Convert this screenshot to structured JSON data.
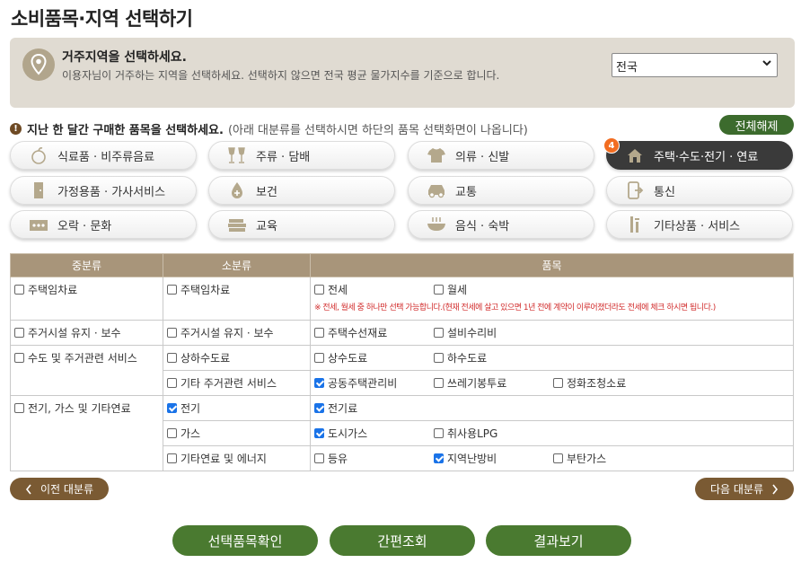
{
  "title": "소비품목·지역 선택하기",
  "region": {
    "heading": "거주지역을 선택하세요.",
    "desc": "이용자님이 거주하는 지역을 선택하세요. 선택하지 않으면 전국 평균 물가지수를 기준으로 합니다.",
    "selected": "전국"
  },
  "instruction": {
    "main": "지난 한 달간 구매한 품목을 선택하세요.",
    "sub": "(아래 대분류를 선택하시면 하단의 품목 선택화면이 나옵니다)"
  },
  "clear_all": "전체해제",
  "categories": [
    {
      "label": "식료품 · 비주류음료",
      "icon": "apple-icon"
    },
    {
      "label": "주류 · 담배",
      "icon": "wine-glasses-icon"
    },
    {
      "label": "의류 · 신발",
      "icon": "shirt-icon"
    },
    {
      "label": "주택·수도·전기 · 연료",
      "icon": "house-icon",
      "active": true,
      "badge": "4"
    },
    {
      "label": "가정용품 · 가사서비스",
      "icon": "door-icon"
    },
    {
      "label": "보건",
      "icon": "drop-icon"
    },
    {
      "label": "교통",
      "icon": "car-icon"
    },
    {
      "label": "통신",
      "icon": "phone-icon"
    },
    {
      "label": "오락 · 문화",
      "icon": "theater-icon"
    },
    {
      "label": "교육",
      "icon": "books-icon"
    },
    {
      "label": "음식 · 숙박",
      "icon": "bowl-icon"
    },
    {
      "label": "기타상품 · 서비스",
      "icon": "tools-icon"
    }
  ],
  "table": {
    "headers": [
      "중분류",
      "소분류",
      "품목"
    ],
    "mid": [
      "주택임차료",
      "주거시설 유지 · 보수",
      "수도 및 주거관련 서비스",
      "전기, 가스 및 기타연료"
    ],
    "sub": [
      "주택임차료",
      "주거시설 유지 · 보수",
      "상하수도료",
      "기타 주거관련 서비스",
      "전기",
      "가스",
      "기타연료 및 에너지"
    ],
    "items": {
      "jeonse": "전세",
      "wolse": "월세",
      "note": "※ 전세, 월세 중 하나만 선택 가능합니다.(현재 전세에 살고 있으면 1년 전에 계약이 이루어졌더라도 전세에 체크 하시면 됩니다.)",
      "repair_mat": "주택수선재료",
      "repair_svc": "설비수리비",
      "water": "상수도료",
      "sewer": "하수도료",
      "mgmt": "공동주택관리비",
      "trash": "쓰레기봉투료",
      "septic": "정화조청소료",
      "elec": "전기료",
      "citygas": "도시가스",
      "lpg": "취사용LPG",
      "kerosene": "등유",
      "district": "지역난방비",
      "butane": "부탄가스"
    }
  },
  "prev_label": "이전 대분류",
  "next_label": "다음 대분류",
  "actions": [
    "선택품목확인",
    "간편조회",
    "결과보기"
  ]
}
